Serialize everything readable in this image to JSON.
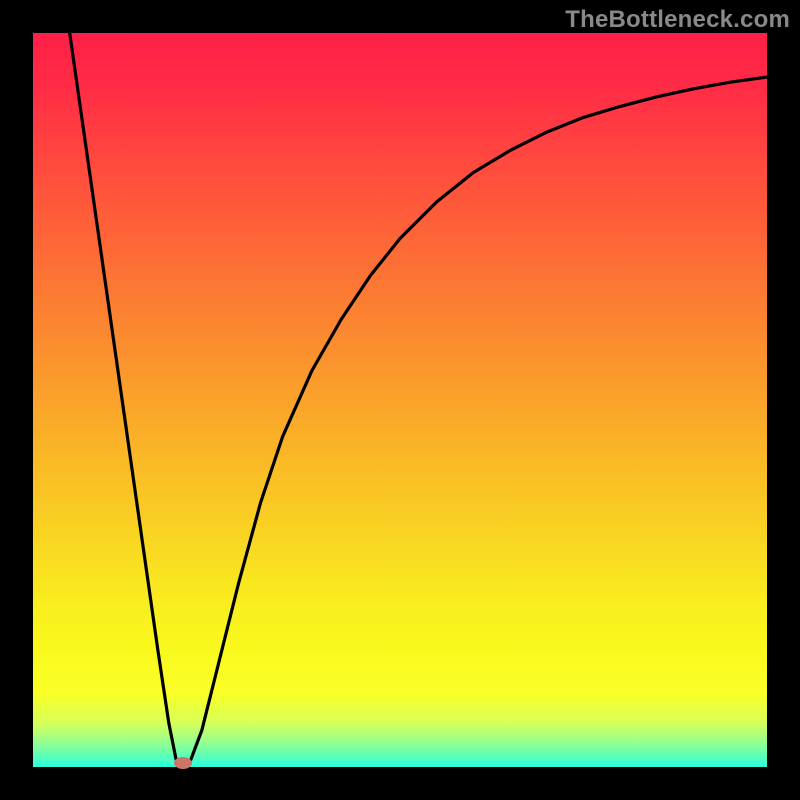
{
  "watermark": "TheBottleneck.com",
  "colors": {
    "frame": "#000000",
    "curve": "#000000",
    "dot": "#cd7667",
    "gradient_top": "#ff1f47",
    "gradient_bottom": "#2affde"
  },
  "chart_data": {
    "type": "line",
    "title": "",
    "xlabel": "",
    "ylabel": "",
    "xlim": [
      0,
      100
    ],
    "ylim": [
      0,
      100
    ],
    "grid": false,
    "legend": false,
    "series": [
      {
        "name": "bottleneck-curve",
        "x": [
          5.0,
          7.0,
          9.0,
          11.0,
          13.0,
          15.0,
          17.0,
          18.5,
          19.5,
          20.5,
          21.5,
          23.0,
          25.0,
          28.0,
          31.0,
          34.0,
          38.0,
          42.0,
          46.0,
          50.0,
          55.0,
          60.0,
          65.0,
          70.0,
          75.0,
          80.0,
          85.0,
          90.0,
          95.0,
          100.0
        ],
        "y": [
          100.0,
          86.0,
          72.0,
          58.0,
          44.0,
          30.0,
          16.0,
          6.0,
          1.0,
          0.5,
          1.0,
          5.0,
          13.0,
          25.0,
          36.0,
          45.0,
          54.0,
          61.0,
          67.0,
          72.0,
          77.0,
          81.0,
          84.0,
          86.5,
          88.5,
          90.0,
          91.3,
          92.4,
          93.3,
          94.0
        ]
      }
    ],
    "marker": {
      "x": 20.5,
      "y": 0.5
    }
  }
}
